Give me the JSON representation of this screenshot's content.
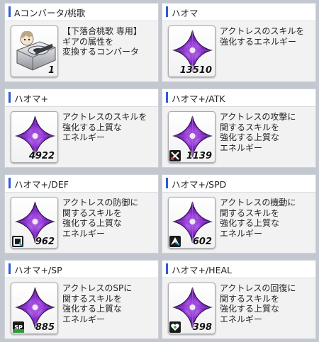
{
  "items": [
    {
      "name": "Aコンバータ/桃歌",
      "description": "【下落合桃歌 専用】\nギアの属性を\n変換するコンバータ",
      "quantity": "1",
      "icon": "converter-device-icon",
      "badge": ""
    },
    {
      "name": "ハオマ",
      "description": "アクトレスのスキルを\n強化するエネルギー",
      "quantity": "13510",
      "icon": "haoma-crystal-icon",
      "badge": ""
    },
    {
      "name": "ハオマ+",
      "description": "アクトレスのスキルを\n強化する上質な\nエネルギー",
      "quantity": "4922",
      "icon": "haoma-crystal-icon",
      "badge": ""
    },
    {
      "name": "ハオマ+/ATK",
      "description": "アクトレスの攻撃に\n関するスキルを\n強化する上質な\nエネルギー",
      "quantity": "1139",
      "icon": "haoma-crystal-icon",
      "badge": "atk-swords-icon"
    },
    {
      "name": "ハオマ+/DEF",
      "description": "アクトレスの防御に\n関するスキルを\n強化する上質な\nエネルギー",
      "quantity": "962",
      "icon": "haoma-crystal-icon",
      "badge": "def-shield-icon"
    },
    {
      "name": "ハオマ+/SPD",
      "description": "アクトレスの機動に\n関するスキルを\n強化する上質な\nエネルギー",
      "quantity": "602",
      "icon": "haoma-crystal-icon",
      "badge": "spd-wing-icon"
    },
    {
      "name": "ハオマ+/SP",
      "description": "アクトレスのSPに\n関するスキルを\n強化する上質な\nエネルギー",
      "quantity": "885",
      "icon": "haoma-crystal-icon",
      "badge": "sp-icon"
    },
    {
      "name": "ハオマ+/HEAL",
      "description": "アクトレスの回復に\n関するスキルを\n強化する上質な\nエネルギー",
      "quantity": "398",
      "icon": "haoma-crystal-icon",
      "badge": "heal-heart-icon"
    }
  ],
  "badge_labels": {
    "sp": "SP"
  },
  "colors": {
    "accent": "#2f5bd6",
    "crystal_dark": "#2a0d45",
    "crystal_mid": "#8b2fd0",
    "crystal_light": "#e6b8ff",
    "badge_atk": "#e23a3a",
    "badge_def": "#2aa3e0",
    "badge_spd": "#2aa3e0",
    "badge_sp": "#2e9b3a",
    "badge_heal": "#3aa64a"
  }
}
